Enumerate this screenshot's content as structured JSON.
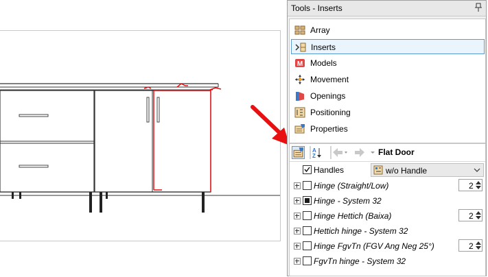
{
  "panel": {
    "title": "Tools - Inserts",
    "pin_icon": "pin-icon"
  },
  "menu": {
    "items": [
      {
        "label": "Array",
        "icon": "array-icon",
        "selected": false
      },
      {
        "label": "Inserts",
        "icon": "inserts-icon",
        "selected": true
      },
      {
        "label": "Models",
        "icon": "models-icon",
        "selected": false
      },
      {
        "label": "Movement",
        "icon": "movement-icon",
        "selected": false
      },
      {
        "label": "Openings",
        "icon": "openings-icon",
        "selected": false
      },
      {
        "label": "Positioning",
        "icon": "positioning-icon",
        "selected": false
      },
      {
        "label": "Properties",
        "icon": "properties-icon",
        "selected": false
      }
    ]
  },
  "props": {
    "object_name": "Flat Door",
    "handles": {
      "label": "Handles",
      "checked": true,
      "value": "w/o Handle"
    },
    "rows": [
      {
        "label": "Hinge (Straight/Low)",
        "checked": false,
        "qty": "2"
      },
      {
        "label": "Hinge - System 32",
        "checked": "partial",
        "qty": ""
      },
      {
        "label": "Hinge Hettich (Baixa)",
        "checked": false,
        "qty": "2"
      },
      {
        "label": "Hettich hinge - System 32",
        "checked": false,
        "qty": ""
      },
      {
        "label": "Hinge FgvTn (FGV Ang Neg 25°)",
        "checked": false,
        "qty": "2"
      },
      {
        "label": "FgvTn hinge - System 32",
        "checked": false,
        "qty": ""
      }
    ]
  },
  "colors": {
    "accent": "#5b9bd5",
    "selection_bg": "#eaf4fc",
    "annotation_red": "#e81010"
  }
}
